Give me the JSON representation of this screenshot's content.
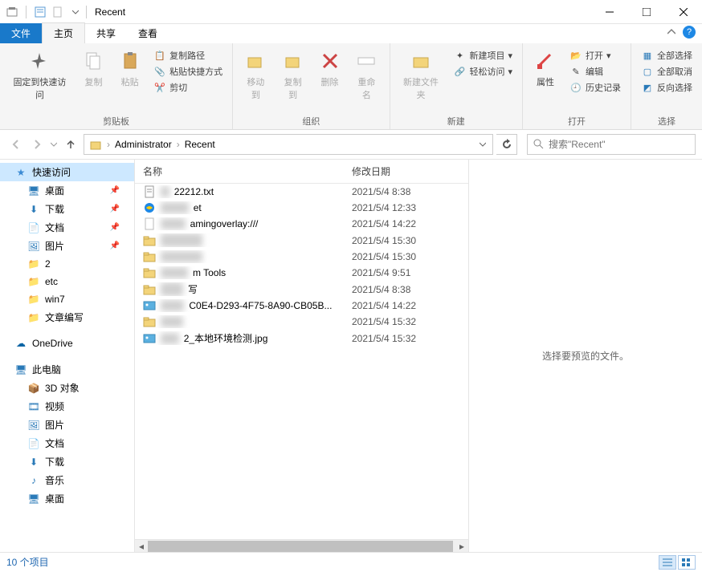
{
  "window": {
    "title": "Recent"
  },
  "tabs": {
    "file": "文件",
    "home": "主页",
    "share": "共享",
    "view": "查看"
  },
  "ribbon": {
    "clipboard": {
      "pin": "固定到快速访问",
      "copy": "复制",
      "paste": "粘贴",
      "copy_path": "复制路径",
      "paste_shortcut": "粘贴快捷方式",
      "cut": "剪切",
      "label": "剪贴板"
    },
    "organize": {
      "move": "移动到",
      "copy_to": "复制到",
      "delete": "删除",
      "rename": "重命名",
      "label": "组织"
    },
    "new": {
      "new_folder": "新建文件夹",
      "new_item": "新建项目",
      "easy_access": "轻松访问",
      "label": "新建"
    },
    "open": {
      "properties": "属性",
      "open": "打开",
      "edit": "编辑",
      "history": "历史记录",
      "label": "打开"
    },
    "select": {
      "select_all": "全部选择",
      "select_none": "全部取消",
      "invert": "反向选择",
      "label": "选择"
    }
  },
  "breadcrumb": {
    "seg1": "Administrator",
    "seg2": "Recent"
  },
  "search": {
    "placeholder": "搜索\"Recent\""
  },
  "nav": {
    "quick_access": "快速访问",
    "desktop": "桌面",
    "downloads": "下载",
    "documents": "文档",
    "pictures": "图片",
    "folder2": "2",
    "etc": "etc",
    "win7": "win7",
    "article": "文章编写",
    "onedrive": "OneDrive",
    "this_pc": "此电脑",
    "objects3d": "3D 对象",
    "videos": "视频",
    "pictures2": "图片",
    "documents2": "文档",
    "downloads2": "下载",
    "music": "音乐",
    "desktop2": "桌面"
  },
  "columns": {
    "name": "名称",
    "date": "修改日期"
  },
  "files": [
    {
      "name_hidden": "1",
      "name_visible": "22212.txt",
      "date": "2021/5/4 8:38",
      "icon": "text"
    },
    {
      "name_hidden": "Intern",
      "name_visible": "et",
      "date": "2021/5/4 12:33",
      "icon": "ie"
    },
    {
      "name_hidden": "ms-g",
      "name_visible": "amingoverlay:///",
      "date": "2021/5/4 14:22",
      "icon": "doc"
    },
    {
      "name_hidden": "系统文件",
      "name_visible": "",
      "date": "2021/5/4 15:30",
      "icon": "folder"
    },
    {
      "name_hidden": "xxxxxxxx",
      "name_visible": "",
      "date": "2021/5/4 15:30",
      "icon": "folder"
    },
    {
      "name_hidden": "Syste",
      "name_visible": "m Tools",
      "date": "2021/5/4 9:51",
      "icon": "folder"
    },
    {
      "name_hidden": "填写",
      "name_visible": "写",
      "date": "2021/5/4 8:38",
      "icon": "folder"
    },
    {
      "name_hidden": "{8E8",
      "name_visible": "C0E4-D293-4F75-8A90-CB05B...",
      "date": "2021/5/4 14:22",
      "icon": "pic"
    },
    {
      "name_hidden": "xxxx",
      "name_visible": "",
      "date": "2021/5/4 15:32",
      "icon": "folder"
    },
    {
      "name_hidden": "xx0",
      "name_visible": "2_本地环境检测.jpg",
      "date": "2021/5/4 15:32",
      "icon": "pic"
    }
  ],
  "preview": {
    "empty": "选择要预览的文件。"
  },
  "status": {
    "count": "10 个项目"
  }
}
